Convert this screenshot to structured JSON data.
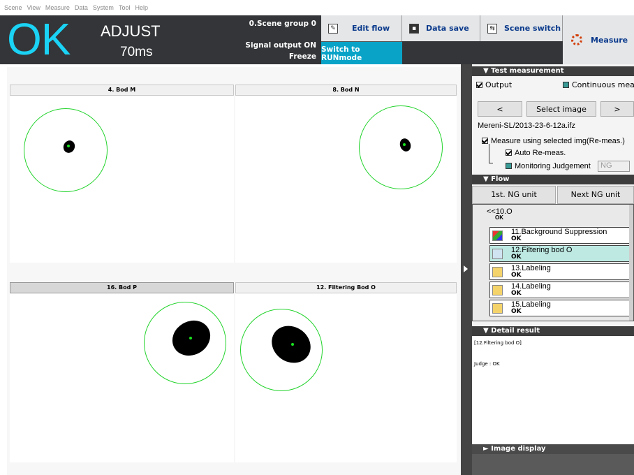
{
  "menu": [
    "Scene",
    "View",
    "Measure",
    "Data",
    "System",
    "Tool",
    "Help"
  ],
  "status": {
    "judge": "OK",
    "mode": "ADJUST",
    "time": "70ms",
    "scene_group": "0.Scene group 0",
    "signal": "Signal output ON",
    "freeze": "Freeze",
    "accent_color": "#1ad3f5"
  },
  "toolbar": {
    "edit_flow": "Edit flow",
    "data_save": "Data save",
    "scene_switch": "Scene switch",
    "run_mode": "Switch to RUNmode",
    "measure": "Measure"
  },
  "panels": [
    {
      "title": "4. Bod M"
    },
    {
      "title": "8. Bod N"
    },
    {
      "title": "16. Bod P"
    },
    {
      "title": "12. Filtering Bod O"
    }
  ],
  "test_measurement": {
    "title": "Test measurement",
    "output_label": "Output",
    "output_checked": true,
    "continuous_label": "Continuous meas",
    "continuous_checked": false,
    "prev": "<",
    "select_image": "Select image",
    "next": ">",
    "file": "Mereni-SL/2013-23-6-12a.ifz",
    "measure_selected": "Measure using selected img(Re-meas.)",
    "auto_remeas": "Auto Re-meas.",
    "monitoring": "Monitoring Judgement",
    "monitoring_value": "NG"
  },
  "flow": {
    "title": "Flow",
    "first_ng": "1st. NG unit",
    "next_ng": "Next NG unit",
    "group_label": "<<",
    "group_name": "10.O",
    "group_status": "OK",
    "items": [
      {
        "name": "11.Background Suppression",
        "status": "OK"
      },
      {
        "name": "12.Filtering bod O",
        "status": "OK"
      },
      {
        "name": "13.Labeling",
        "status": "OK"
      },
      {
        "name": "14.Labeling",
        "status": "OK"
      },
      {
        "name": "15.Labeling",
        "status": "OK"
      }
    ]
  },
  "detail": {
    "title": "Detail result",
    "unit": "[12.Filtering bod O]",
    "judge": "Judge : OK"
  },
  "image_display": {
    "title": "Image display"
  }
}
